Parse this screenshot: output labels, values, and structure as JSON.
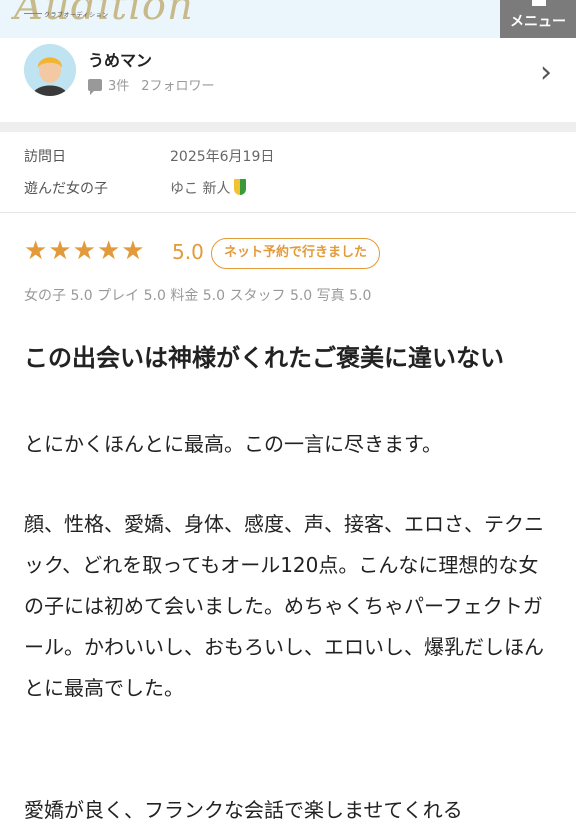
{
  "header": {
    "logo_text": "Audition",
    "logo_sub": "クラブオーディション",
    "menu_label": "メニュー"
  },
  "reviewer": {
    "name": "うめマン",
    "posts": "3件",
    "followers": "2フォロワー"
  },
  "visit": {
    "date_label": "訪問日",
    "date_value": "2025年6月19日",
    "girl_label": "遊んだ女の子",
    "girl_value": "ゆこ 新人"
  },
  "rating": {
    "stars": 5,
    "score": "5.0",
    "badge": "ネット予約で行きました",
    "subscores": "女の子 5.0 プレイ 5.0 料金 5.0 スタッフ 5.0 写真 5.0"
  },
  "review": {
    "title": "この出会いは神様がくれたご褒美に違いない",
    "paragraph1": "とにかくほんとに最高。この一言に尽きます。",
    "paragraph2": "顔、性格、愛嬌、身体、感度、声、接客、エロさ、テクニック、どれを取ってもオール120点。こんなに理想的な女の子には初めて会いました。めちゃくちゃパーフェクトガール。かわいいし、おもろいし、エロいし、爆乳だしほんとに最高でした。",
    "paragraph3": "愛嬌が良く、フランクな会話で楽しませてくれる"
  },
  "colors": {
    "accent": "#e39a3b",
    "header_bg": "#eaf6fb",
    "menu_bg": "#7b7b7b"
  }
}
